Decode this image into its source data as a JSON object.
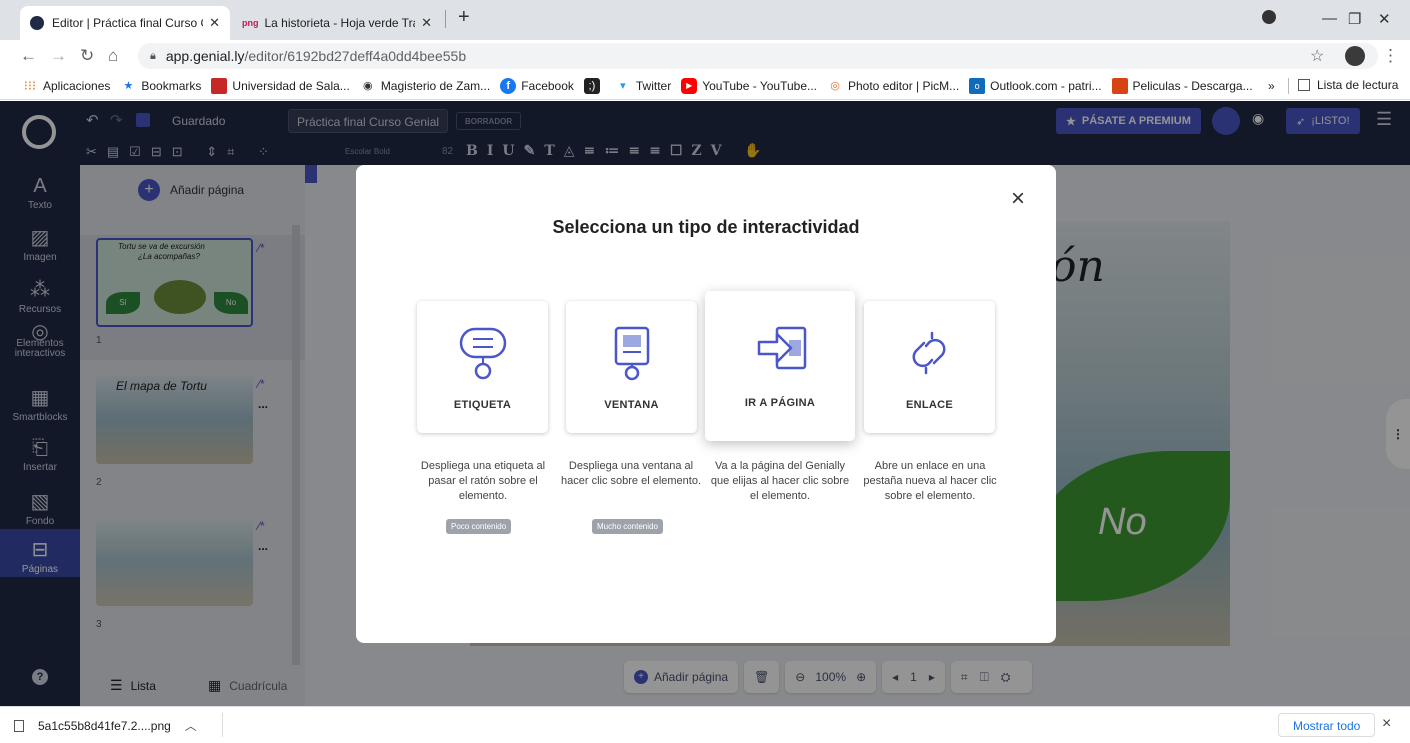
{
  "browser": {
    "tabs": [
      {
        "title": "Editor | Práctica final Curso Genia",
        "active": true
      },
      {
        "favicon_text": "png",
        "title": "La historieta - Hoja verde Transpa",
        "active": false
      }
    ],
    "new_tab": "+",
    "url_host": "app.genial.ly",
    "url_path": "/editor/6192bd27deff4a0dd4bee55b",
    "bookmarks": [
      {
        "label": "Aplicaciones",
        "icon": "apps-grid-icon"
      },
      {
        "label": "Bookmarks",
        "icon": "star-icon"
      },
      {
        "label": "Universidad de Sala...",
        "icon": "university-icon"
      },
      {
        "label": "Magisterio de Zam...",
        "icon": "globe-icon"
      },
      {
        "label": "Facebook",
        "icon": "facebook-icon"
      },
      {
        "label": "",
        "icon": "bracket-icon"
      },
      {
        "label": "Twitter",
        "icon": "twitter-icon"
      },
      {
        "label": "YouTube - YouTube...",
        "icon": "youtube-icon"
      },
      {
        "label": "Photo editor | PicM...",
        "icon": "picmonkey-icon"
      },
      {
        "label": "Outlook.com - patri...",
        "icon": "outlook-icon"
      },
      {
        "label": "Peliculas - Descarga...",
        "icon": "film-icon"
      }
    ],
    "more_bookmarks": "»",
    "reading_list": "Lista de lectura"
  },
  "editor": {
    "saved": "Guardado",
    "doc_title": "Práctica final Curso Genial",
    "draft_badge": "BORRADOR",
    "premium": "PÁSATE A PREMIUM",
    "ready": "¡LISTO!",
    "font_name": "Escolar Bold",
    "font_size": "82",
    "rail": [
      {
        "label": "Texto",
        "icon": "text-icon"
      },
      {
        "label": "Imagen",
        "icon": "image-icon"
      },
      {
        "label": "Recursos",
        "icon": "resources-icon"
      },
      {
        "label": "Elementos interactivos",
        "icon": "interactive-icon"
      },
      {
        "label": "Smartblocks",
        "icon": "smartblocks-icon"
      },
      {
        "label": "Insertar",
        "icon": "insert-icon"
      },
      {
        "label": "Fondo",
        "icon": "background-icon"
      },
      {
        "label": "Páginas",
        "icon": "pages-icon"
      }
    ],
    "add_page": "Añadir página",
    "pages": [
      {
        "number": "1",
        "thumb_line1": "Tortu se va de excursión",
        "thumb_line2": "¿La acompañas?",
        "yes": "Sí",
        "no": "No"
      },
      {
        "number": "2",
        "thumb_line1": "El mapa de Tortu"
      },
      {
        "number": "3"
      }
    ],
    "more_dots": "...",
    "view_list": "Lista",
    "view_grid": "Cuadrícula",
    "slide_text_partial": "ón",
    "slide_leaf_text": "No",
    "bottom": {
      "add_page": "Añadir página",
      "zoom": "100%",
      "page": "1"
    }
  },
  "modal": {
    "title": "Selecciona un tipo de interactividad",
    "close": "×",
    "options": [
      {
        "label": "ETIQUETA",
        "description": "Despliega una etiqueta al pasar el ratón sobre el elemento.",
        "tag": "Poco contenido",
        "icon": "label-tooltip-icon"
      },
      {
        "label": "VENTANA",
        "description": "Despliega una ventana al hacer clic sobre el elemento.",
        "tag": "Mucho contenido",
        "icon": "window-icon"
      },
      {
        "label": "IR A PÁGINA",
        "description": "Va a la página del Genially que elijas al hacer clic sobre el elemento.",
        "tag": "",
        "icon": "go-to-page-icon"
      },
      {
        "label": "ENLACE",
        "description": "Abre un enlace en una pestaña nueva al hacer clic sobre el elemento.",
        "tag": "",
        "icon": "link-icon"
      }
    ],
    "accent_color": "#4b57c9"
  },
  "downloads": {
    "file": "5a1c55b8d41fe7.2....png",
    "show_all": "Mostrar todo",
    "close": "×"
  }
}
